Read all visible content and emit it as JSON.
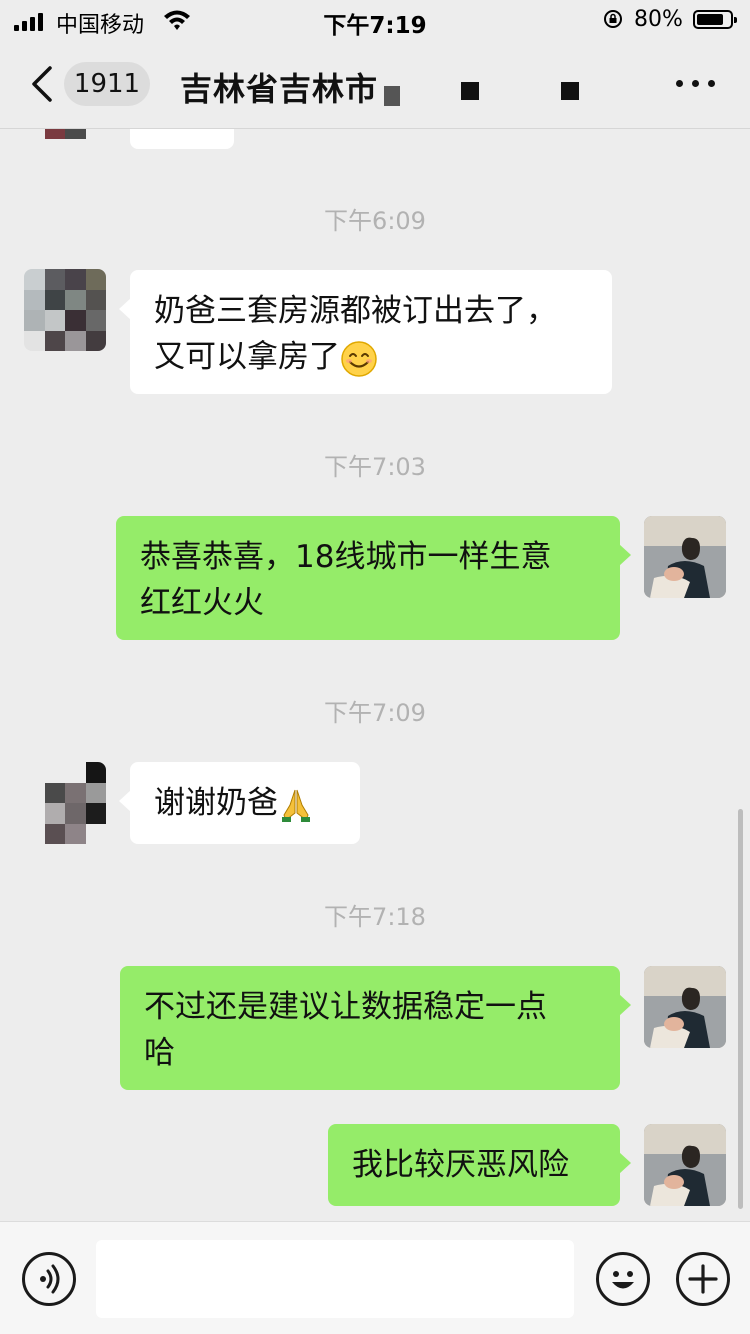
{
  "status_bar": {
    "carrier": "中国移动",
    "time": "下午7:19",
    "battery": "80%",
    "battery_level": 0.8
  },
  "nav": {
    "back_count": "1911",
    "title": "吉林省吉林市"
  },
  "messages": [
    {
      "type": "time",
      "text": "下午6:09"
    },
    {
      "type": "in",
      "line1": "奶爸三套房源都被订出去了，",
      "line2": "又可以拿房了",
      "emoji": "smiling-face-icon"
    },
    {
      "type": "time",
      "text": "下午7:03"
    },
    {
      "type": "out",
      "line1": "恭喜恭喜，18线城市一样生意",
      "line2": "红红火火"
    },
    {
      "type": "time",
      "text": "下午7:09"
    },
    {
      "type": "in",
      "line1": "谢谢奶爸",
      "emoji": "folded-hands-icon"
    },
    {
      "type": "time",
      "text": "下午7:18"
    },
    {
      "type": "out",
      "line1": "不过还是建议让数据稳定一点",
      "line2": "哈"
    },
    {
      "type": "out",
      "line1": "我比较厌恶风险"
    }
  ],
  "input_bar": {
    "voice_icon": "voice-icon",
    "emoji_icon": "emoji-icon",
    "plus_icon": "plus-icon",
    "value": ""
  },
  "colors": {
    "background": "#ededed",
    "outgoing_bubble": "#95ec69",
    "incoming_bubble": "#ffffff",
    "timestamp": "#b2b2b2"
  }
}
